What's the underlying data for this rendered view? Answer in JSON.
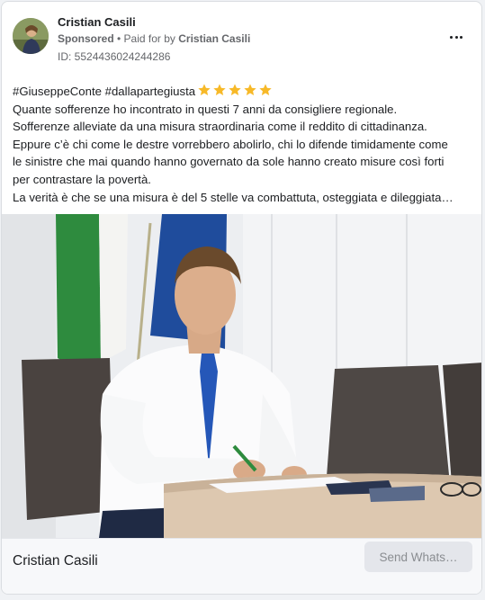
{
  "ad": {
    "page_name": "Cristian Casili",
    "sponsored_label": "Sponsored",
    "separator": " • ",
    "paid_for_prefix": "Paid for by ",
    "paid_for_by": "Cristian Casili",
    "id_line": "ID: 5524436024244286",
    "avatar_icon": "profile-photo",
    "more_icon": "more-options-icon"
  },
  "post": {
    "hashtags": "#GiuseppeConte #dallapartegiusta",
    "star_count": 5,
    "star_color": "#f7b928",
    "lines": [
      "Quante sofferenze ho incontrato in questi 7 anni da consigliere regionale.",
      "Sofferenze alleviate da una misura straordinaria come il reddito di cittadinanza.",
      "Eppure c’è chi come le destre vorrebbero abolirlo, chi lo difende timidamente come",
      "le sinistre che mai quando hanno governato da sole hanno creato misure così forti",
      "per contrastare la povertà.",
      "La verità è che se una misura è del 5 stelle va combattuta, osteggiata e dileggiata…"
    ]
  },
  "footer": {
    "title": "Cristian Casili",
    "cta_label": "Send Whats…"
  }
}
